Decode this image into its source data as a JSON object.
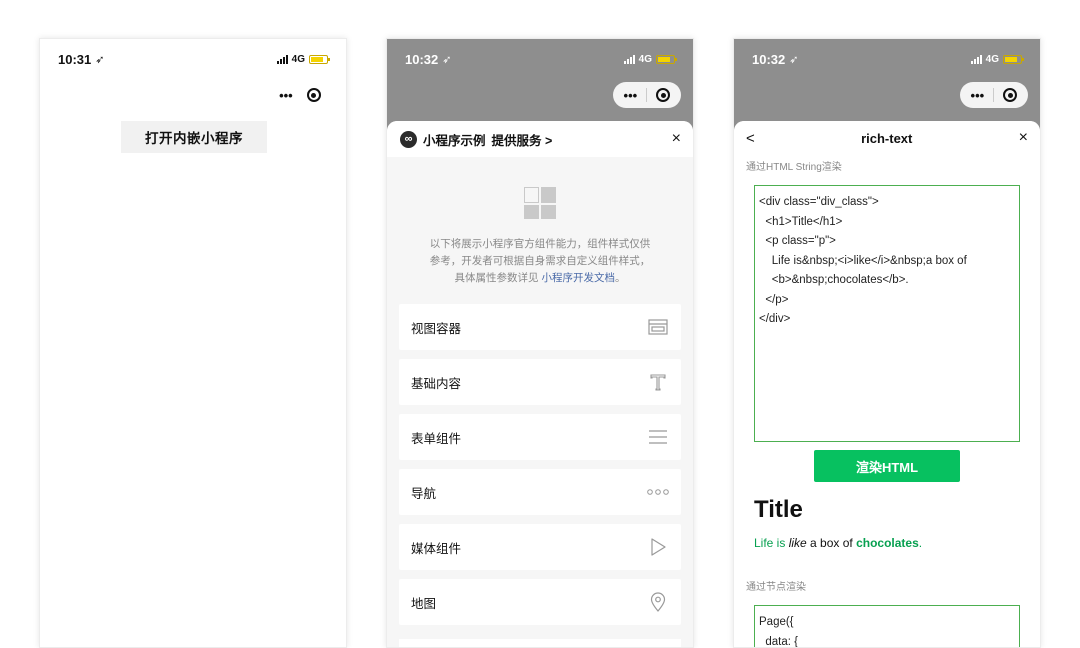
{
  "phone1": {
    "time": "10:31",
    "network": "4G",
    "open_button": "打开内嵌小程序"
  },
  "phone2": {
    "time": "10:32",
    "network": "4G",
    "brand_name": "小程序示例",
    "brand_service": "提供服务 >",
    "close": "×",
    "intro_line1": "以下将展示小程序官方组件能力，组件样式仅供",
    "intro_line2": "参考，开发者可根据自身需求自定义组件样式，",
    "intro_line3_prefix": "具体属性参数详见 ",
    "intro_link": "小程序开发文档",
    "intro_line3_suffix": "。",
    "menu": [
      {
        "label": "视图容器",
        "icon": "view-container-icon"
      },
      {
        "label": "基础内容",
        "icon": "text-icon"
      },
      {
        "label": "表单组件",
        "icon": "list-lines-icon"
      },
      {
        "label": "导航",
        "icon": "dots-icon"
      },
      {
        "label": "媒体组件",
        "icon": "play-icon"
      },
      {
        "label": "地图",
        "icon": "map-pin-icon"
      }
    ]
  },
  "phone3": {
    "time": "10:32",
    "network": "4G",
    "back": "<",
    "title": "rich-text",
    "close": "×",
    "label_html": "通过HTML String渲染",
    "code_html": "<div class=\"div_class\">\n  <h1>Title</h1>\n  <p class=\"p\">\n    Life is&nbsp;<i>like</i>&nbsp;a box of\n    <b>&nbsp;chocolates</b>.\n  </p>\n</div>",
    "render_button": "渲染HTML",
    "rendered_title": "Title",
    "rendered_line_1": "Life is ",
    "rendered_italic": "like",
    "rendered_line_2": " a box of ",
    "rendered_bold": "chocolates",
    "rendered_line_3": ".",
    "label_nodes": "通过节点渲染",
    "code_nodes": "Page({\n  data: {"
  }
}
